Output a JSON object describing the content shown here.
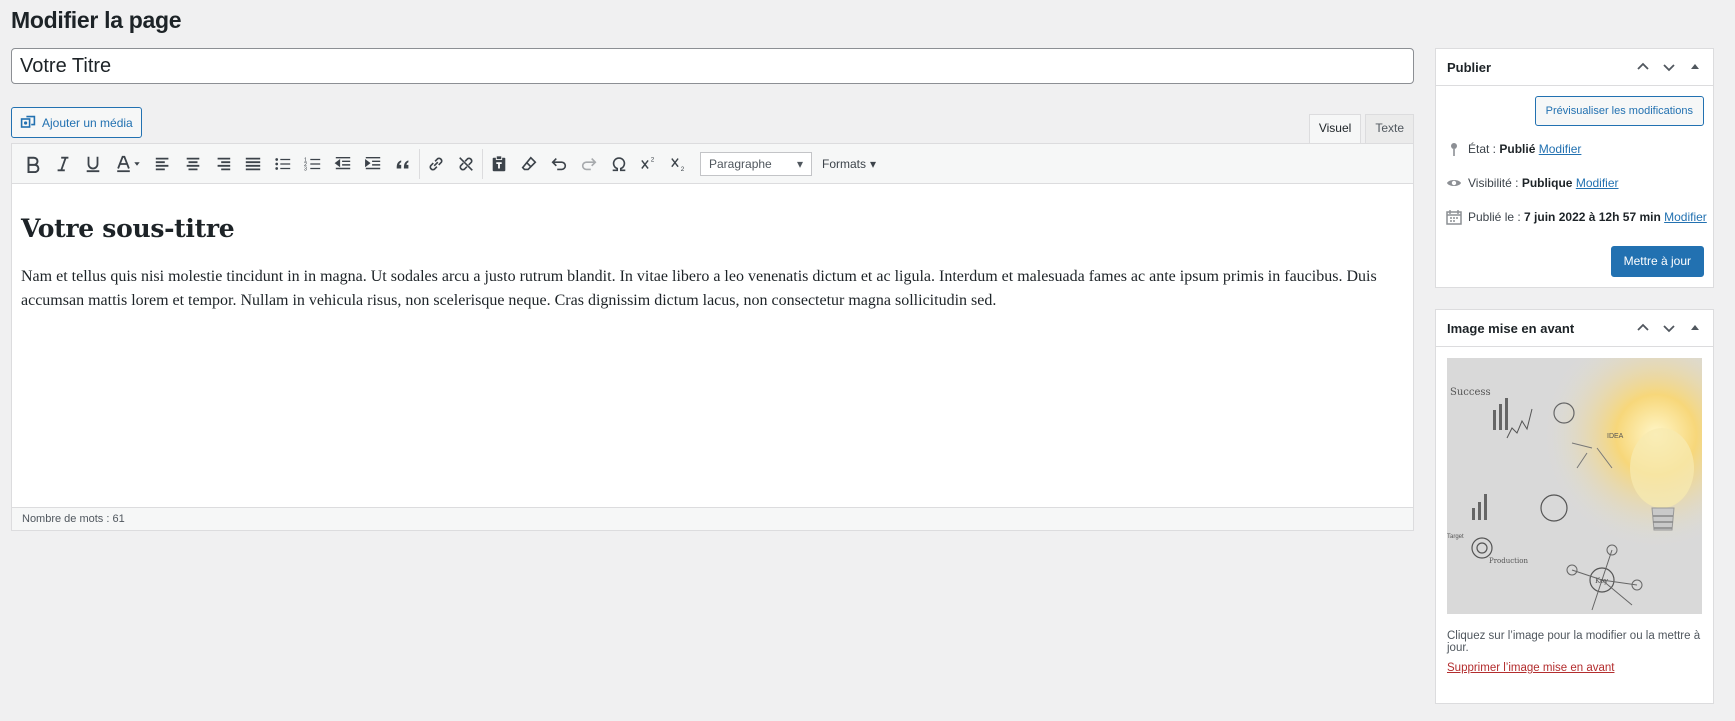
{
  "page": {
    "title": "Modifier la page"
  },
  "title_field": {
    "value": "Votre Titre"
  },
  "media": {
    "label": "Ajouter un média"
  },
  "tabs": [
    {
      "label": "Visuel",
      "active": true
    },
    {
      "label": "Texte",
      "active": false
    }
  ],
  "toolbar": {
    "buttons": [
      "bold-icon",
      "italic-icon",
      "underline-icon",
      "text-color-icon",
      "align-left-icon",
      "align-center-icon",
      "align-right-icon",
      "justify-icon",
      "bullet-list-icon",
      "numbered-list-icon",
      "outdent-icon",
      "indent-icon",
      "blockquote-icon",
      "link-icon",
      "unlink-icon",
      "paste-text-icon",
      "clear-format-icon",
      "undo-icon",
      "redo-icon",
      "omega-icon",
      "superscript-icon",
      "subscript-icon"
    ],
    "paragraph_select": "Paragraphe",
    "formats_label": "Formats"
  },
  "content": {
    "heading": "Votre sous-titre",
    "paragraph": "Nam et tellus quis nisi molestie tincidunt in in magna. Ut sodales arcu a justo rutrum blandit. In vitae libero a leo venenatis dictum et ac ligula. Interdum et malesuada fames ac ante ipsum primis in faucibus. Duis accumsan mattis lorem et tempor. Nullam in vehicula risus, non scelerisque neque. Cras dignissim dictum lacus, non consectetur magna sollicitudin sed."
  },
  "status": {
    "word_count": "Nombre de mots : 61"
  },
  "publish": {
    "title": "Publier",
    "preview_label": "Prévisualiser les modifications",
    "state_label": "État :",
    "state_value": "Publié",
    "visibility_label": "Visibilité :",
    "visibility_value": "Publique",
    "published_label": "Publié le :",
    "published_value": "7 juin 2022 à 12h 57 min",
    "modify_label": "Modifier",
    "update_label": "Mettre à jour"
  },
  "featured": {
    "title": "Image mise en avant",
    "caption": "Cliquez sur l’image pour la modifier ou la mettre à jour.",
    "remove_label": "Supprimer l’image mise en avant",
    "image_texts": {
      "success": "Success",
      "idea": "IDEA",
      "target": "Target",
      "production": "Production",
      "key": "Key"
    }
  },
  "colors": {
    "accent": "#2271b1",
    "danger": "#b32d2e",
    "background": "#f0f0f1"
  }
}
